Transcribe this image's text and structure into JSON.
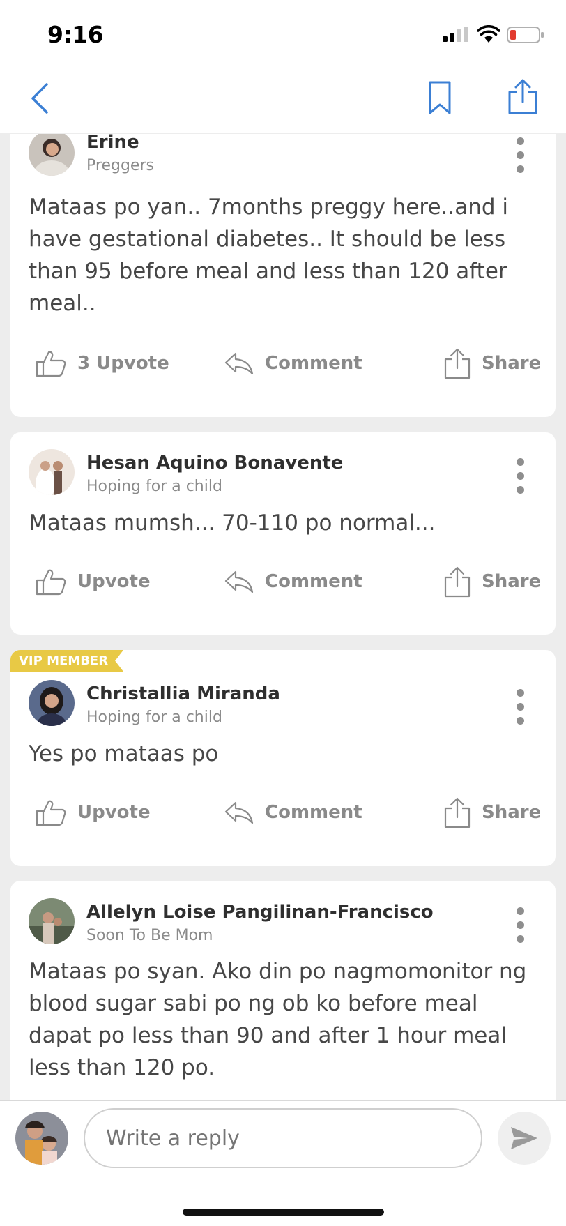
{
  "status_bar": {
    "time": "9:16"
  },
  "nav": {
    "back": "back-icon",
    "bookmark": "bookmark-icon",
    "share": "share-icon"
  },
  "comments": [
    {
      "author": "Erine",
      "status": "Preggers",
      "text": "Mataas po yan.. 7months preggy here..and i have gestational diabetes.. It should be less than 95 before meal and less than 120 after meal..",
      "actions": {
        "upvote": "3 Upvote",
        "comment": "Comment",
        "share": "Share"
      }
    },
    {
      "author": "Hesan Aquino Bonavente",
      "status": "Hoping for a child",
      "text": "Mataas mumsh... 70-110 po normal...",
      "actions": {
        "upvote": "Upvote",
        "comment": "Comment",
        "share": "Share"
      }
    },
    {
      "badge": "VIP MEMBER",
      "author": "Christallia Miranda",
      "status": "Hoping for a child",
      "text": "Yes po mataas po",
      "actions": {
        "upvote": "Upvote",
        "comment": "Comment",
        "share": "Share"
      }
    },
    {
      "author": "Allelyn Loise Pangilinan-Francisco",
      "status": "Soon To Be Mom",
      "text": "Mataas po syan. Ako din po nagmomonitor ng blood sugar sabi po ng ob ko before meal dapat po less than 90 and after 1 hour meal less than 120 po."
    }
  ],
  "reply": {
    "placeholder": "Write a reply"
  },
  "colors": {
    "accent": "#3b7fd4",
    "vip_badge": "#e8c945",
    "action_gray": "#8a8a8a"
  }
}
